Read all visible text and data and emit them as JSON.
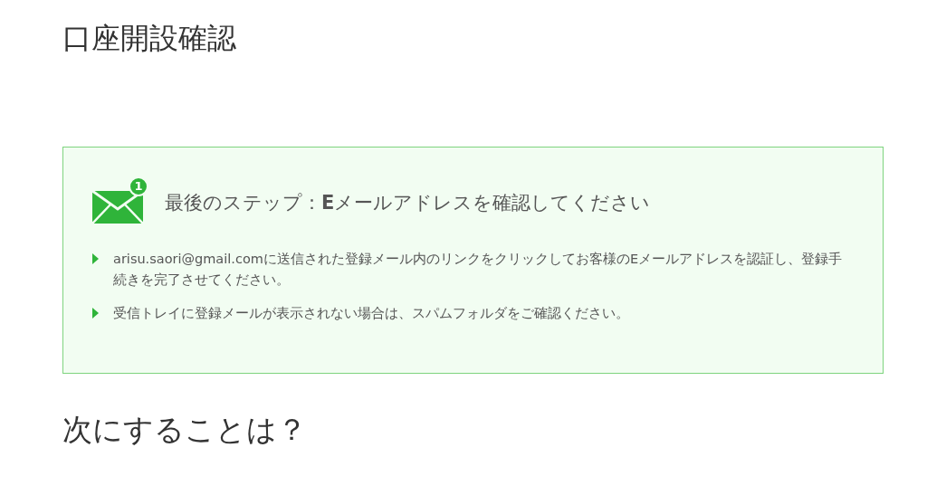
{
  "page_title": "口座開設確認",
  "notice": {
    "badge": "1",
    "title": "最後のステップ：**E**メールアドレスを確認してください",
    "items": [
      "arisu.saori@gmail.comに送信された登録メール内のリンクをクリックしてお客様のEメールアドレスを認証し、登録手続きを完了させてください。",
      "受信トレイに登録メールが表示されない場合は、スパムフォルダをご確認ください。"
    ]
  },
  "next_heading": "次にすることは？"
}
